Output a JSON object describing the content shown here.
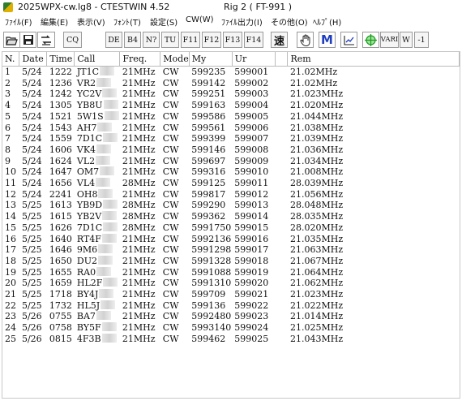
{
  "window": {
    "title": "2025WPX-cw.lg8 - CTESTWIN 4.52",
    "rig": "Rig 2 ( FT-991 )"
  },
  "menu": [
    "ﾌｧｲﾙ(F)",
    "編集(E)",
    "表示(V)",
    "ﾌｫﾝﾄ(T)",
    "設定(S)",
    "CW(W)",
    "ﾌｧｲﾙ出力(I)",
    "その他(O)",
    "ﾍﾙﾌﾟ(H)"
  ],
  "toolbar": {
    "buttons": [
      "CQ",
      "DE",
      "B4",
      "N?",
      "TU",
      "F11",
      "F12",
      "F13",
      "F14",
      "速",
      "VARI",
      "W",
      "-1"
    ]
  },
  "log": {
    "columns": [
      "N.",
      "Date",
      "Time",
      "Call",
      "Freq.",
      "Mode",
      "My",
      "Ur",
      "",
      "Rem"
    ],
    "rows": [
      {
        "n": "1",
        "date": "5/24",
        "time": "1222",
        "call": "JT1C",
        "freq": "21MHz",
        "mode": "CW",
        "my": "599235",
        "ur": "599001",
        "rem": "21.02MHz"
      },
      {
        "n": "2",
        "date": "5/24",
        "time": "1236",
        "call": "VR2",
        "freq": "21MHz",
        "mode": "CW",
        "my": "599142",
        "ur": "599002",
        "rem": "21.02MHz"
      },
      {
        "n": "3",
        "date": "5/24",
        "time": "1242",
        "call": "YC2V",
        "freq": "21MHz",
        "mode": "CW",
        "my": "599251",
        "ur": "599003",
        "rem": "21.023MHz"
      },
      {
        "n": "4",
        "date": "5/24",
        "time": "1305",
        "call": "YB8U",
        "freq": "21MHz",
        "mode": "CW",
        "my": "599163",
        "ur": "599004",
        "rem": "21.020MHz"
      },
      {
        "n": "5",
        "date": "5/24",
        "time": "1521",
        "call": "5W1S",
        "freq": "21MHz",
        "mode": "CW",
        "my": "599586",
        "ur": "599005",
        "rem": "21.044MHz"
      },
      {
        "n": "6",
        "date": "5/24",
        "time": "1543",
        "call": "AH7",
        "freq": "21MHz",
        "mode": "CW",
        "my": "599561",
        "ur": "599006",
        "rem": "21.038MHz"
      },
      {
        "n": "7",
        "date": "5/24",
        "time": "1559",
        "call": "7D1C",
        "freq": "21MHz",
        "mode": "CW",
        "my": "599399",
        "ur": "599007",
        "rem": "21.039MHz"
      },
      {
        "n": "8",
        "date": "5/24",
        "time": "1606",
        "call": "VK4",
        "freq": "21MHz",
        "mode": "CW",
        "my": "599146",
        "ur": "599008",
        "rem": "21.036MHz"
      },
      {
        "n": "9",
        "date": "5/24",
        "time": "1624",
        "call": "VL2",
        "freq": "21MHz",
        "mode": "CW",
        "my": "599697",
        "ur": "599009",
        "rem": "21.034MHz"
      },
      {
        "n": "10",
        "date": "5/24",
        "time": "1647",
        "call": "OM7",
        "freq": "21MHz",
        "mode": "CW",
        "my": "599316",
        "ur": "599010",
        "rem": "21.008MHz"
      },
      {
        "n": "11",
        "date": "5/24",
        "time": "1656",
        "call": "VL4",
        "freq": "28MHz",
        "mode": "CW",
        "my": "599125",
        "ur": "599011",
        "rem": "28.039MHz"
      },
      {
        "n": "12",
        "date": "5/24",
        "time": "2241",
        "call": "OH8",
        "freq": "21MHz",
        "mode": "CW",
        "my": "599817",
        "ur": "599012",
        "rem": "21.056MHz"
      },
      {
        "n": "13",
        "date": "5/25",
        "time": "1613",
        "call": "YB9D",
        "freq": "28MHz",
        "mode": "CW",
        "my": "599290",
        "ur": "599013",
        "rem": "28.048MHz"
      },
      {
        "n": "14",
        "date": "5/25",
        "time": "1615",
        "call": "YB2V",
        "freq": "28MHz",
        "mode": "CW",
        "my": "599362",
        "ur": "599014",
        "rem": "28.035MHz"
      },
      {
        "n": "15",
        "date": "5/25",
        "time": "1626",
        "call": "7D1C",
        "freq": "28MHz",
        "mode": "CW",
        "my": "5991750",
        "ur": "599015",
        "rem": "28.020MHz"
      },
      {
        "n": "16",
        "date": "5/25",
        "time": "1640",
        "call": "RT4F",
        "freq": "21MHz",
        "mode": "CW",
        "my": "5992136",
        "ur": "599016",
        "rem": "21.035MHz"
      },
      {
        "n": "17",
        "date": "5/25",
        "time": "1646",
        "call": "9M6",
        "freq": "21MHz",
        "mode": "CW",
        "my": "5991298",
        "ur": "599017",
        "rem": "21.063MHz"
      },
      {
        "n": "18",
        "date": "5/25",
        "time": "1650",
        "call": "DU2",
        "freq": "21MHz",
        "mode": "CW",
        "my": "5991328",
        "ur": "599018",
        "rem": "21.067MHz"
      },
      {
        "n": "19",
        "date": "5/25",
        "time": "1655",
        "call": "RA0",
        "freq": "21MHz",
        "mode": "CW",
        "my": "5991088",
        "ur": "599019",
        "rem": "21.064MHz"
      },
      {
        "n": "20",
        "date": "5/25",
        "time": "1659",
        "call": "HL2F",
        "freq": "21MHz",
        "mode": "CW",
        "my": "5991310",
        "ur": "599020",
        "rem": "21.062MHz"
      },
      {
        "n": "21",
        "date": "5/25",
        "time": "1718",
        "call": "BY4J",
        "freq": "21MHz",
        "mode": "CW",
        "my": "599709",
        "ur": "599021",
        "rem": "21.023MHz"
      },
      {
        "n": "22",
        "date": "5/25",
        "time": "1732",
        "call": "HL5J",
        "freq": "21MHz",
        "mode": "CW",
        "my": "599136",
        "ur": "599022",
        "rem": "21.022MHz"
      },
      {
        "n": "23",
        "date": "5/26",
        "time": "0755",
        "call": "BA7",
        "freq": "21MHz",
        "mode": "CW",
        "my": "5992480",
        "ur": "599023",
        "rem": "21.014MHz"
      },
      {
        "n": "24",
        "date": "5/26",
        "time": "0758",
        "call": "BY5F",
        "freq": "21MHz",
        "mode": "CW",
        "my": "5993140",
        "ur": "599024",
        "rem": "21.025MHz"
      },
      {
        "n": "25",
        "date": "5/26",
        "time": "0815",
        "call": "4F3B",
        "freq": "21MHz",
        "mode": "CW",
        "my": "599462",
        "ur": "599025",
        "rem": "21.043MHz"
      }
    ]
  },
  "icons": [
    "open-folder-icon",
    "save-disk-icon",
    "audio-switch-icon",
    "hand-icon",
    "M-letter-icon",
    "graph-icon",
    "globe-icon"
  ],
  "colors": {
    "accent_blue": "#1f3fbf",
    "globe_green": "#1b9c1b"
  }
}
